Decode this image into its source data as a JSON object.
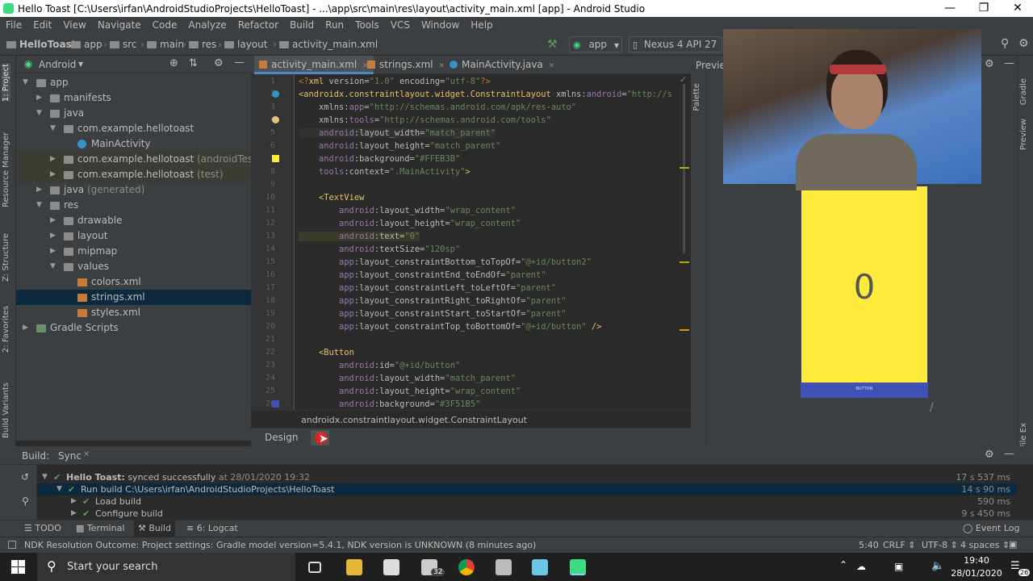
{
  "window": {
    "title": "Hello Toast [C:\\Users\\irfan\\AndroidStudioProjects\\HelloToast] - ...\\app\\src\\main\\res\\layout\\activity_main.xml [app] - Android Studio"
  },
  "menu": [
    "File",
    "Edit",
    "View",
    "Navigate",
    "Code",
    "Analyze",
    "Refactor",
    "Build",
    "Run",
    "Tools",
    "VCS",
    "Window",
    "Help"
  ],
  "breadcrumb": [
    "HelloToast",
    "app",
    "src",
    "main",
    "res",
    "layout",
    "activity_main.xml"
  ],
  "toolbar": {
    "run_config": "app",
    "device": "Nexus 4 API 27",
    "preview_label": "Preview"
  },
  "project": {
    "view_mode": "Android",
    "tree": [
      {
        "label": "app",
        "indent": 0,
        "arrow": "▼",
        "icon": "folder"
      },
      {
        "label": "manifests",
        "indent": 1,
        "arrow": "▶",
        "icon": "folder"
      },
      {
        "label": "java",
        "indent": 1,
        "arrow": "▼",
        "icon": "folder"
      },
      {
        "label": "com.example.hellotoast",
        "indent": 2,
        "arrow": "▼",
        "icon": "package"
      },
      {
        "label": "MainActivity",
        "indent": 3,
        "arrow": "",
        "icon": "class"
      },
      {
        "label": "com.example.hellotoast",
        "suffix": "(androidTest)",
        "indent": 2,
        "arrow": "▶",
        "icon": "package",
        "hl": true
      },
      {
        "label": "com.example.hellotoast",
        "suffix": "(test)",
        "indent": 2,
        "arrow": "▶",
        "icon": "package",
        "hl": true
      },
      {
        "label": "java",
        "suffix": "(generated)",
        "indent": 1,
        "arrow": "▶",
        "icon": "folder"
      },
      {
        "label": "res",
        "indent": 1,
        "arrow": "▼",
        "icon": "folder"
      },
      {
        "label": "drawable",
        "indent": 2,
        "arrow": "▶",
        "icon": "folder"
      },
      {
        "label": "layout",
        "indent": 2,
        "arrow": "▶",
        "icon": "folder"
      },
      {
        "label": "mipmap",
        "indent": 2,
        "arrow": "▶",
        "icon": "folder"
      },
      {
        "label": "values",
        "indent": 2,
        "arrow": "▼",
        "icon": "folder"
      },
      {
        "label": "colors.xml",
        "indent": 3,
        "arrow": "",
        "icon": "xml"
      },
      {
        "label": "strings.xml",
        "indent": 3,
        "arrow": "",
        "icon": "xml",
        "sel": true
      },
      {
        "label": "styles.xml",
        "indent": 3,
        "arrow": "",
        "icon": "xml"
      },
      {
        "label": "Gradle Scripts",
        "indent": 0,
        "arrow": "▶",
        "icon": "gradle"
      }
    ]
  },
  "left_strip_tabs": [
    "1: Project",
    "Resource Manager",
    "Z: Structure",
    "2: Favorites",
    "Build Variants"
  ],
  "editor_tabs": [
    {
      "label": "activity_main.xml",
      "active": true
    },
    {
      "label": "strings.xml",
      "active": false
    },
    {
      "label": "MainActivity.java",
      "active": false
    }
  ],
  "code_lines": [
    {
      "n": "1",
      "html": "<span class=\"p\">&lt;?</span><span class=\"tag\">xml </span><span class=\"a\">version=</span><span class=\"v\">\"1.0\"</span><span class=\"a\"> encoding=</span><span class=\"v\">\"utf-8\"</span><span class=\"p\">?&gt;</span>"
    },
    {
      "n": "2",
      "html": "<span class=\"tag\">&lt;androidx.constraintlayout.widget.ConstraintLayout </span><span class=\"a\">xmlns:</span><span class=\"ns\">android</span><span class=\"a\">=</span><span class=\"v\">\"http://s</span>"
    },
    {
      "n": "3",
      "html": "    <span class=\"a\">xmlns:</span><span class=\"ns\">app</span><span class=\"a\">=</span><span class=\"v\">\"http://schemas.android.com/apk/res-auto\"</span>"
    },
    {
      "n": "4",
      "html": "    <span class=\"a\">xmlns:</span><span class=\"ns\">tools</span><span class=\"a\">=</span><span class=\"v\">\"http://schemas.android.com/tools\"</span>"
    },
    {
      "n": "5",
      "html": "    <span class=\"ns\">android</span><span class=\"a\">:layout_width=</span><span class=\"v\">\"match_parent\"</span>"
    },
    {
      "n": "6",
      "html": "    <span class=\"ns\">android</span><span class=\"a\">:layout_height=</span><span class=\"v\">\"match_parent\"</span>"
    },
    {
      "n": "7",
      "html": "    <span class=\"ns\">android</span><span class=\"a\">:background=</span><span class=\"v\">\"#FFEB3B\"</span>"
    },
    {
      "n": "8",
      "html": "    <span class=\"ns\">tools</span><span class=\"a\">:context=</span><span class=\"v\">\".MainActivity\"</span><span class=\"tag\">&gt;</span>"
    },
    {
      "n": "9",
      "html": ""
    },
    {
      "n": "10",
      "html": "    <span class=\"tag\">&lt;TextView</span>"
    },
    {
      "n": "11",
      "html": "        <span class=\"ns\">android</span><span class=\"a\">:layout_width=</span><span class=\"v\">\"wrap_content\"</span>"
    },
    {
      "n": "12",
      "html": "        <span class=\"ns\">android</span><span class=\"a\">:layout_height=</span><span class=\"v\">\"wrap_content\"</span>"
    },
    {
      "n": "13",
      "html": "        <span class=\"ns\">android</span><span class=\"a\">:text=</span><span class=\"v\">\"0\"</span>"
    },
    {
      "n": "14",
      "html": "        <span class=\"ns\">android</span><span class=\"a\">:textSize=</span><span class=\"v\">\"120sp\"</span>"
    },
    {
      "n": "15",
      "html": "        <span class=\"ns\">app</span><span class=\"a\">:layout_constraintBottom_toTopOf=</span><span class=\"v\">\"@+id/button2\"</span>"
    },
    {
      "n": "16",
      "html": "        <span class=\"ns\">app</span><span class=\"a\">:layout_constraintEnd_toEndOf=</span><span class=\"v\">\"parent\"</span>"
    },
    {
      "n": "17",
      "html": "        <span class=\"ns\">app</span><span class=\"a\">:layout_constraintLeft_toLeftOf=</span><span class=\"v\">\"parent\"</span>"
    },
    {
      "n": "18",
      "html": "        <span class=\"ns\">app</span><span class=\"a\">:layout_constraintRight_toRightOf=</span><span class=\"v\">\"parent\"</span>"
    },
    {
      "n": "19",
      "html": "        <span class=\"ns\">app</span><span class=\"a\">:layout_constraintStart_toStartOf=</span><span class=\"v\">\"parent\"</span>"
    },
    {
      "n": "20",
      "html": "        <span class=\"ns\">app</span><span class=\"a\">:layout_constraintTop_toBottomOf=</span><span class=\"v\">\"@+id/button\"</span><span class=\"tag\"> /&gt;</span>"
    },
    {
      "n": "21",
      "html": ""
    },
    {
      "n": "22",
      "html": "    <span class=\"tag\">&lt;Button</span>"
    },
    {
      "n": "23",
      "html": "        <span class=\"ns\">android</span><span class=\"a\">:id=</span><span class=\"v\">\"@+id/button\"</span>"
    },
    {
      "n": "24",
      "html": "        <span class=\"ns\">android</span><span class=\"a\">:layout_width=</span><span class=\"v\">\"match_parent\"</span>"
    },
    {
      "n": "25",
      "html": "        <span class=\"ns\">android</span><span class=\"a\">:layout_height=</span><span class=\"v\">\"wrap_content\"</span>"
    },
    {
      "n": "26",
      "html": "        <span class=\"ns\">android</span><span class=\"a\">:background=</span><span class=\"v\">\"#3F51B5\"</span>"
    }
  ],
  "editor_status": "androidx.constraintlayout.widget.ConstraintLayout",
  "design_tabs": {
    "design": "Design",
    "text": "T"
  },
  "preview": {
    "counter": "0",
    "button_text": "BUTTON",
    "bg_color": "#FFEB3B",
    "button_color": "#3F51B5"
  },
  "build": {
    "title": "Build:",
    "sync_tab": "Sync",
    "rows": [
      {
        "label": "Hello Toast:",
        "text": " synced successfully",
        "meta": " at 28/01/2020 19:32",
        "time": "17 s 537 ms",
        "indent": 0,
        "arrow": "▼"
      },
      {
        "label": "",
        "text": "Run build C:\\Users\\irfan\\AndroidStudioProjects\\HelloToast",
        "meta": "",
        "time": "14 s 90 ms",
        "indent": 1,
        "arrow": "▼",
        "sel": true
      },
      {
        "label": "",
        "text": "Load build",
        "meta": "",
        "time": "590 ms",
        "indent": 2,
        "arrow": "▶"
      },
      {
        "label": "",
        "text": "Configure build",
        "meta": "",
        "time": "9 s 450 ms",
        "indent": 2,
        "arrow": "▶"
      }
    ]
  },
  "bottom_tabs": [
    "TODO",
    "Terminal",
    "Build",
    "6: Logcat"
  ],
  "event_log": "Event Log",
  "status": {
    "message": "NDK Resolution Outcome: Project settings: Gradle model version=5.4.1, NDK version is UNKNOWN (8 minutes ago)",
    "position": "5:40",
    "line_sep": "CRLF",
    "encoding": "UTF-8",
    "indent": "4 spaces"
  },
  "taskbar": {
    "search_placeholder": "Start your search",
    "time": "19:40",
    "date": "28/01/2020",
    "mail_badge": "32",
    "notif_badge": "26"
  }
}
